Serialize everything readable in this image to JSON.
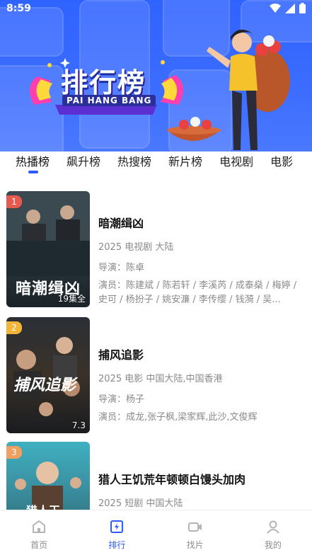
{
  "status_bar": {
    "time": "8:59"
  },
  "banner": {
    "title": "排行榜",
    "subtitle": "PAI HANG BANG"
  },
  "tabs": [
    {
      "label": "热播榜",
      "active": true
    },
    {
      "label": "飙升榜",
      "active": false
    },
    {
      "label": "热搜榜",
      "active": false
    },
    {
      "label": "新片榜",
      "active": false
    },
    {
      "label": "电视剧",
      "active": false
    },
    {
      "label": "电影",
      "active": false
    }
  ],
  "list": [
    {
      "rank": "1",
      "rank_color": "#e85a4f",
      "poster_corner": "19集全",
      "poster_title": "暗潮缉凶",
      "title": "暗潮缉凶",
      "meta": "2025 电视剧 大陆",
      "director": "导演：陈卓",
      "cast": "演员：陈建斌 / 陈若轩 / 李溪芮 / 成泰燊 / 梅婷 / 史可 / 杨扮子 / 姚安濂 / 李传缨 / 钱漪 / 吴..."
    },
    {
      "rank": "2",
      "rank_color": "#f2b53a",
      "poster_corner": "7.3",
      "poster_title": "捕风追影",
      "title": "捕风追影",
      "meta": "2025 电影 中国大陆,中国香港",
      "director": "导演：杨子",
      "cast": "演员：成龙,张子枫,梁家辉,此沙,文俊辉"
    },
    {
      "rank": "3",
      "rank_color": "#f0a060",
      "poster_corner": "",
      "poster_title": "猎人王",
      "title": "猎人王饥荒年顿顿白馒头加肉",
      "meta": "2025 短剧 中国大陆",
      "director": "",
      "cast": ""
    }
  ],
  "bottom_nav": [
    {
      "label": "首页",
      "icon": "home-icon",
      "active": false
    },
    {
      "label": "排行",
      "icon": "ranking-icon",
      "active": true
    },
    {
      "label": "找片",
      "icon": "video-camera-icon",
      "active": false
    },
    {
      "label": "我的",
      "icon": "user-icon",
      "active": false
    }
  ],
  "colors": {
    "accent": "#2d5bff",
    "banner": "#3b6cff"
  }
}
